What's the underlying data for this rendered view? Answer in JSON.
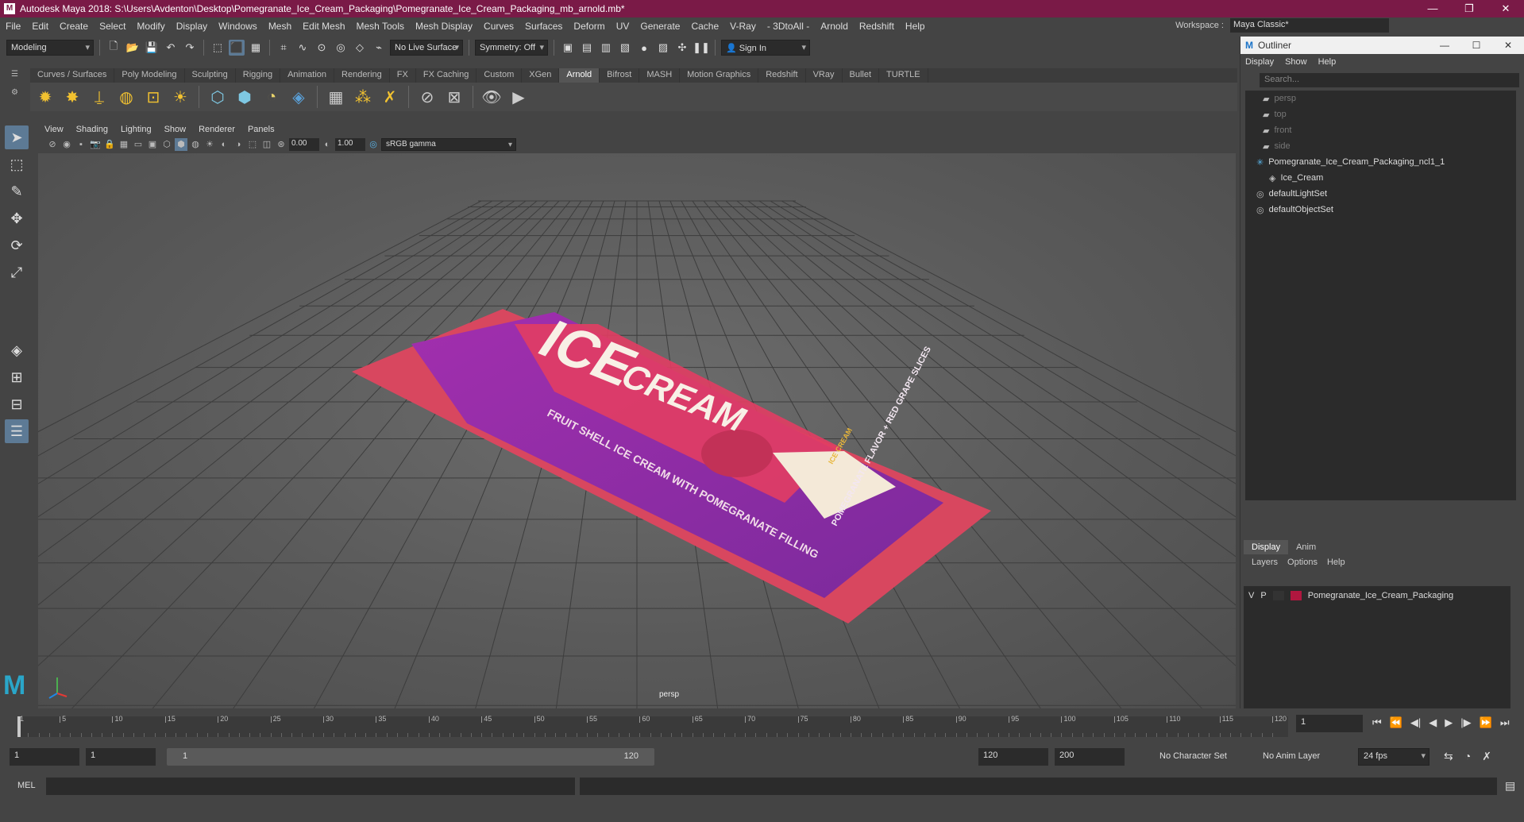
{
  "titlebar": {
    "title": "Autodesk Maya 2018: S:\\Users\\Avdenton\\Desktop\\Pomegranate_Ice_Cream_Packaging\\Pomegranate_Ice_Cream_Packaging_mb_arnold.mb*",
    "min": "—",
    "max": "❐",
    "close": "✕"
  },
  "menu": [
    "File",
    "Edit",
    "Create",
    "Select",
    "Modify",
    "Display",
    "Windows",
    "Mesh",
    "Edit Mesh",
    "Mesh Tools",
    "Mesh Display",
    "Curves",
    "Surfaces",
    "Deform",
    "UV",
    "Generate",
    "Cache",
    "V-Ray",
    "- 3DtoAll -",
    "Arnold",
    "Redshift",
    "Help"
  ],
  "workspace": {
    "label": "Workspace :",
    "value": "Maya Classic*"
  },
  "statusline": {
    "mode": "Modeling",
    "live_surface": "No Live Surface",
    "symmetry": "Symmetry: Off",
    "sign_in": "Sign In"
  },
  "shelf_tabs": [
    "Curves / Surfaces",
    "Poly Modeling",
    "Sculpting",
    "Rigging",
    "Animation",
    "Rendering",
    "FX",
    "FX Caching",
    "Custom",
    "XGen",
    "Arnold",
    "Bifrost",
    "MASH",
    "Motion Graphics",
    "Redshift",
    "VRay",
    "Bullet",
    "TURTLE"
  ],
  "shelf_active": "Arnold",
  "viewport": {
    "menu": [
      "View",
      "Shading",
      "Lighting",
      "Show",
      "Renderer",
      "Panels"
    ],
    "exposure": "0.00",
    "gamma": "1.00",
    "colorspace": "sRGB gamma",
    "camera": "persp"
  },
  "product": {
    "brand_top": "ICE",
    "brand_main": "CREAM",
    "side_text": "FRUIT SHELL ICE CREAM WITH POMEGRANATE FILLING",
    "badge": "ICE CREAM",
    "flavor": "POMEGRANATE FLAVOR + RED GRAPE SLICES"
  },
  "outliner": {
    "title": "Outliner",
    "menu": [
      "Display",
      "Show",
      "Help"
    ],
    "search_placeholder": "Search...",
    "items": [
      {
        "label": "persp",
        "dim": true,
        "indent": 1
      },
      {
        "label": "top",
        "dim": true,
        "indent": 1
      },
      {
        "label": "front",
        "dim": true,
        "indent": 1
      },
      {
        "label": "side",
        "dim": true,
        "indent": 1
      },
      {
        "label": "Pomegranate_Ice_Cream_Packaging_ncl1_1",
        "dim": false,
        "indent": 0
      },
      {
        "label": "Ice_Cream",
        "dim": false,
        "indent": 2
      },
      {
        "label": "defaultLightSet",
        "dim": false,
        "indent": 0
      },
      {
        "label": "defaultObjectSet",
        "dim": false,
        "indent": 0
      }
    ]
  },
  "layers": {
    "tabs": [
      "Display",
      "Anim"
    ],
    "menu": [
      "Layers",
      "Options",
      "Help"
    ],
    "v": "V",
    "p": "P",
    "layer_name": "Pomegranate_Ice_Cream_Packaging",
    "layer_color": "#b0173f"
  },
  "timeline": {
    "ticks": [
      "1",
      "5",
      "10",
      "15",
      "20",
      "25",
      "30",
      "35",
      "40",
      "45",
      "50",
      "55",
      "60",
      "65",
      "70",
      "75",
      "80",
      "85",
      "90",
      "95",
      "100",
      "105",
      "110",
      "115",
      "120"
    ],
    "current": "1"
  },
  "range": {
    "start": "1",
    "anim_start": "1",
    "slider_start": "1",
    "slider_end": "120",
    "end": "120",
    "anim_end": "200",
    "char_set": "No Character Set",
    "anim_layer": "No Anim Layer",
    "fps": "24 fps"
  },
  "cmdline": {
    "label": "MEL"
  }
}
